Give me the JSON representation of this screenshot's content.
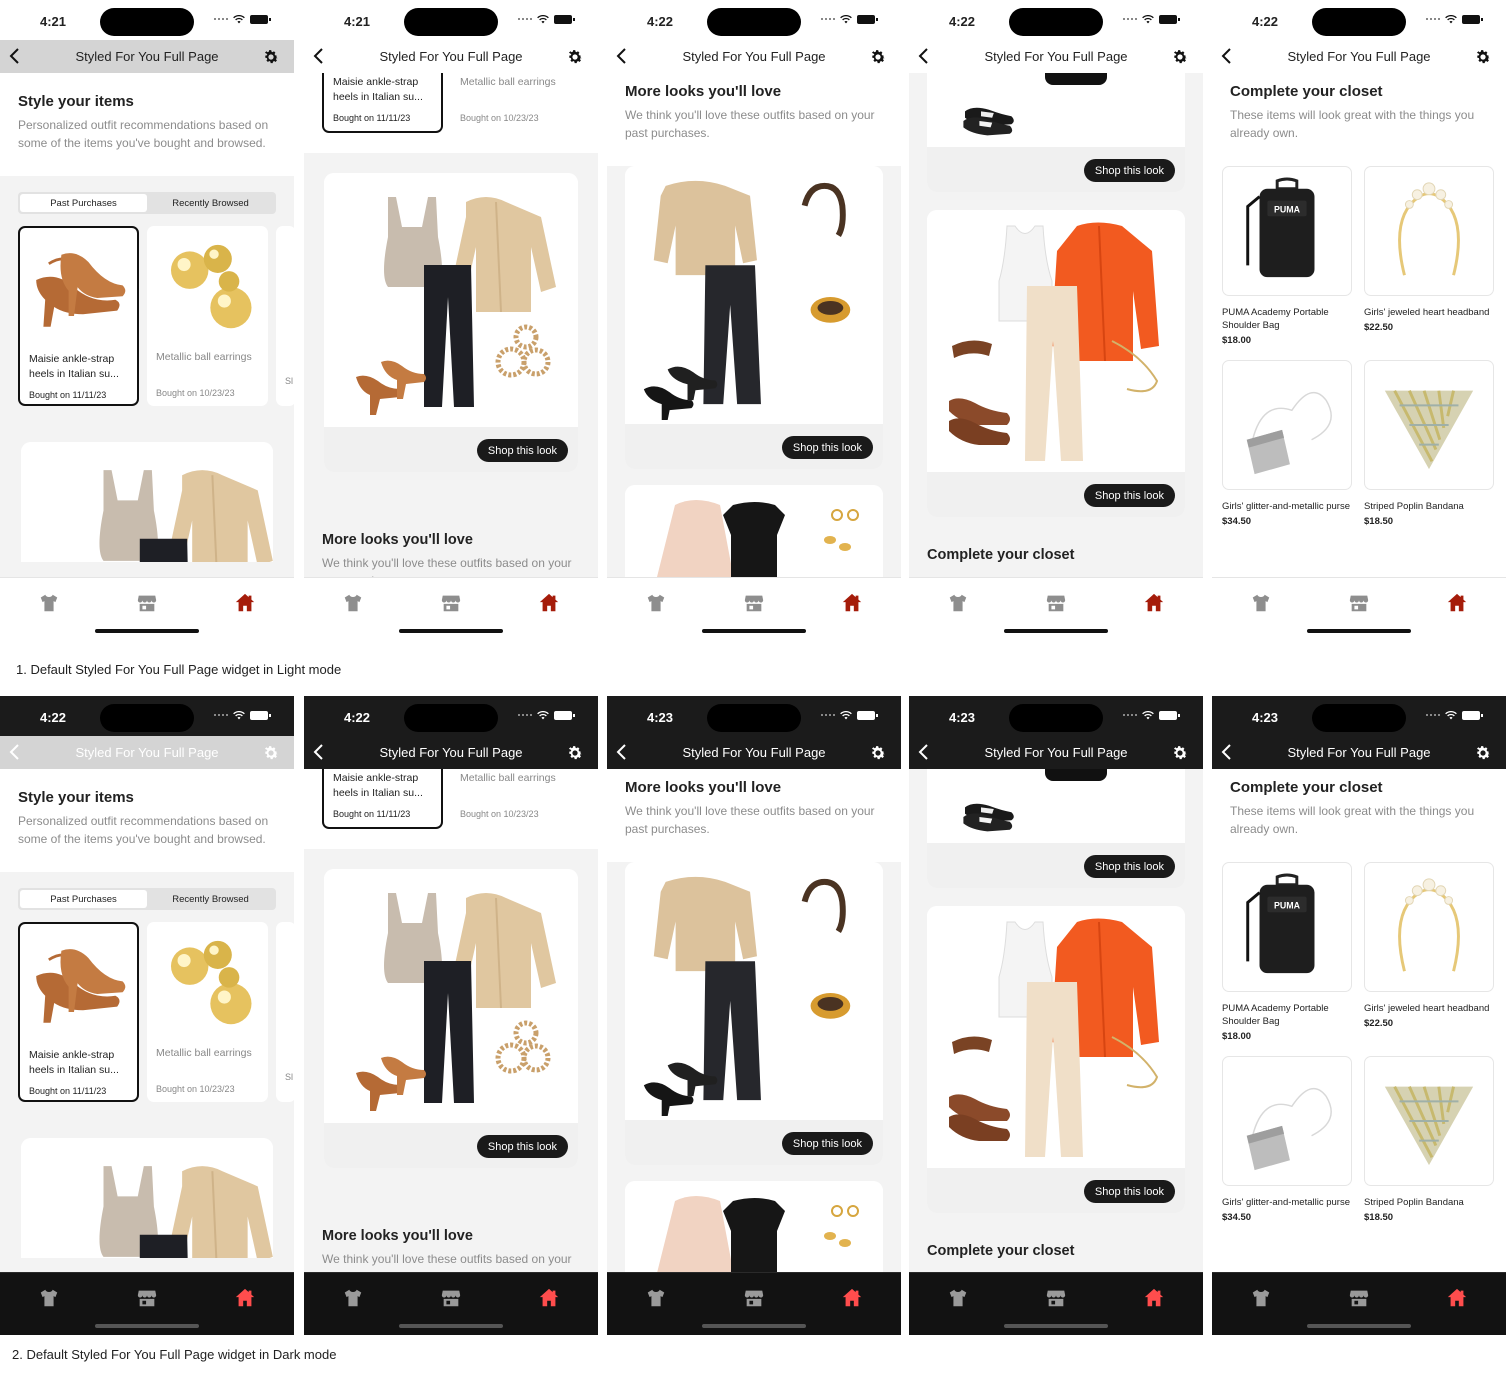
{
  "captions": {
    "light": "1. Default Styled For You Full Page widget in Light mode",
    "dark": "2. Default Styled For You Full Page widget in Dark mode"
  },
  "nav": {
    "title": "Styled For You Full Page",
    "back_icon": "chevron-left-icon",
    "settings_icon": "gear-icon"
  },
  "tabs": [
    "shirt-icon",
    "store-icon",
    "home-icon"
  ],
  "colors": {
    "accent_home_light": "#a51c0a",
    "accent_home_dark": "#ff4d4d",
    "button": "#1a1a1a",
    "muted_text": "#8c8c8c"
  },
  "times": {
    "light": [
      "4:21",
      "4:21",
      "4:22",
      "4:22",
      "4:22"
    ],
    "dark": [
      "4:22",
      "4:22",
      "4:23",
      "4:23",
      "4:23"
    ]
  },
  "style_items": {
    "title": "Style your items",
    "subtitle": "Personalized outfit recommendations based on some of the items you've bought and browsed.",
    "segments": [
      "Past Purchases",
      "Recently Browsed"
    ],
    "products": [
      {
        "name": "Maisie ankle-strap heels in Italian su...",
        "bought": "Bought on 11/11/23"
      },
      {
        "name": "Metallic ball earrings",
        "bought": "Bought on 10/23/23"
      },
      {
        "name": "Sl ca",
        "bought": "Bo"
      }
    ]
  },
  "looks": {
    "shop_label": "Shop this look"
  },
  "more_looks": {
    "title": "More looks you'll love",
    "subtitle": "We think you'll love these outfits based on your past purchases."
  },
  "closet": {
    "title": "Complete your closet",
    "subtitle": "These items will look great with the things you already own.",
    "items": [
      {
        "name": "PUMA Academy Portable Shoulder Bag",
        "price": "$18.00"
      },
      {
        "name": "Girls' jeweled heart headband",
        "price": "$22.50"
      },
      {
        "name": "Girls' glitter-and-metallic purse",
        "price": "$34.50"
      },
      {
        "name": "Striped Poplin Bandana",
        "price": "$18.50"
      }
    ],
    "puma_logo": "PUMA"
  }
}
